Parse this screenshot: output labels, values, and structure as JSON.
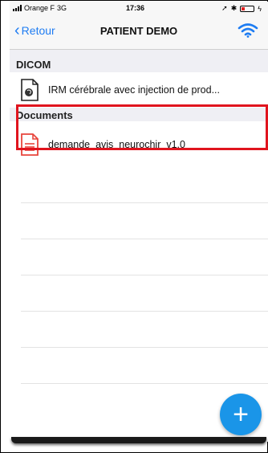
{
  "status_bar": {
    "carrier": "Orange F",
    "network": "3G",
    "time": "17:36"
  },
  "nav": {
    "back_label": "Retour",
    "title": "PATIENT DEMO"
  },
  "sections": {
    "dicom": {
      "header": "DICOM",
      "items": [
        {
          "label": "IRM cérébrale avec injection de prod...",
          "icon": "dicom-file-icon"
        }
      ]
    },
    "documents": {
      "header": "Documents",
      "items": [
        {
          "label": "demande_avis_neurochir_v1.0",
          "icon": "document-icon"
        }
      ]
    }
  },
  "fab": {
    "label": "+"
  },
  "colors": {
    "accent": "#1e7cf2",
    "fab": "#1a95e8",
    "highlight": "#e0141e",
    "document_icon": "#e8453c"
  }
}
